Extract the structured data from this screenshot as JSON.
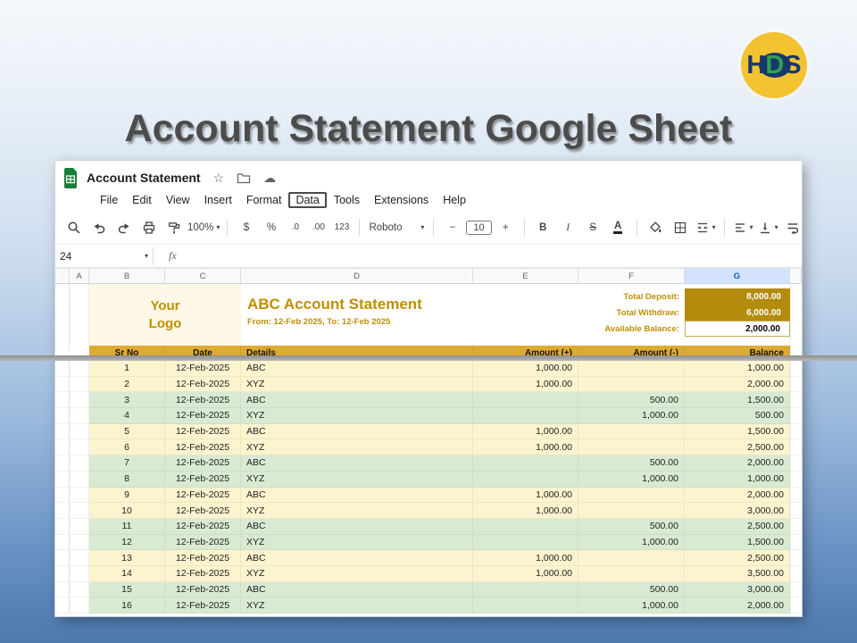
{
  "slide": {
    "title": "Account Statement Google Sheet",
    "logo_letters": {
      "h": "H",
      "d": "D",
      "s": "S"
    }
  },
  "icons": {
    "caret": "▾",
    "star": "☆",
    "cloud": "☁"
  },
  "sheets_app": {
    "doc_title": "Account Statement",
    "menus": [
      "File",
      "Edit",
      "View",
      "Insert",
      "Format",
      "Data",
      "Tools",
      "Extensions",
      "Help"
    ],
    "active_menu": "Data",
    "toolbar": {
      "zoom": "100%",
      "currency": "$",
      "percent": "%",
      "decimal_decrease": ".0",
      "decimal_increase": ".00",
      "more_formats": "123",
      "font": "Roboto",
      "minus": "−",
      "font_size": "10",
      "plus": "+",
      "bold": "B",
      "italic": "I",
      "strikethrough": "S",
      "text_color": "A"
    },
    "name_box": "24",
    "fx_label": "fx",
    "columns": [
      "A",
      "B",
      "C",
      "D",
      "E",
      "F",
      "G"
    ],
    "selected_column": "G"
  },
  "sheet": {
    "logo_text": [
      "Your",
      "Logo"
    ],
    "statement_title": "ABC Account Statement",
    "statement_range": "From: 12-Feb 2025, To: 12-Feb 2025",
    "summary": [
      {
        "label": "Total Deposit:",
        "value": "8,000.00"
      },
      {
        "label": "Total Withdraw:",
        "value": "6,000.00"
      },
      {
        "label": "Available Balance:",
        "value": "2,000.00"
      }
    ],
    "table": {
      "headers": [
        "Sr No",
        "Date",
        "Details",
        "Amount (+)",
        "Amount (-)",
        "Balance"
      ],
      "rows": [
        [
          "1",
          "12-Feb-2025",
          "ABC",
          "1,000.00",
          "",
          "1,000.00"
        ],
        [
          "2",
          "12-Feb-2025",
          "XYZ",
          "1,000.00",
          "",
          "2,000.00"
        ],
        [
          "3",
          "12-Feb-2025",
          "ABC",
          "",
          "500.00",
          "1,500.00"
        ],
        [
          "4",
          "12-Feb-2025",
          "XYZ",
          "",
          "1,000.00",
          "500.00"
        ],
        [
          "5",
          "12-Feb-2025",
          "ABC",
          "1,000.00",
          "",
          "1,500.00"
        ],
        [
          "6",
          "12-Feb-2025",
          "XYZ",
          "1,000.00",
          "",
          "2,500.00"
        ],
        [
          "7",
          "12-Feb-2025",
          "ABC",
          "",
          "500.00",
          "2,000.00"
        ],
        [
          "8",
          "12-Feb-2025",
          "XYZ",
          "",
          "1,000.00",
          "1,000.00"
        ],
        [
          "9",
          "12-Feb-2025",
          "ABC",
          "1,000.00",
          "",
          "2,000.00"
        ],
        [
          "10",
          "12-Feb-2025",
          "XYZ",
          "1,000.00",
          "",
          "3,000.00"
        ],
        [
          "11",
          "12-Feb-2025",
          "ABC",
          "",
          "500.00",
          "2,500.00"
        ],
        [
          "12",
          "12-Feb-2025",
          "XYZ",
          "",
          "1,000.00",
          "1,500.00"
        ],
        [
          "13",
          "12-Feb-2025",
          "ABC",
          "1,000.00",
          "",
          "2,500.00"
        ],
        [
          "14",
          "12-Feb-2025",
          "XYZ",
          "1,000.00",
          "",
          "3,500.00"
        ],
        [
          "15",
          "12-Feb-2025",
          "ABC",
          "",
          "500.00",
          "3,000.00"
        ],
        [
          "16",
          "12-Feb-2025",
          "XYZ",
          "",
          "1,000.00",
          "2,000.00"
        ]
      ]
    }
  }
}
